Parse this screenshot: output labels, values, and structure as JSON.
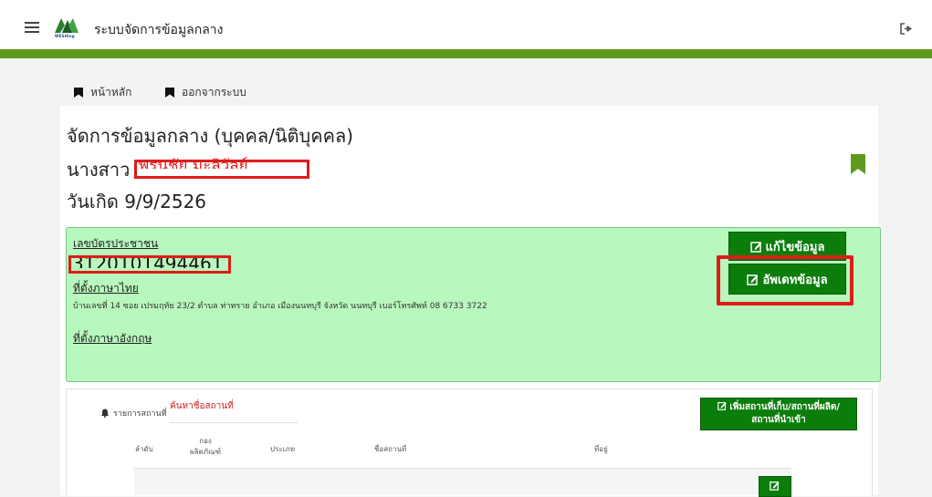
{
  "topbar": {
    "app_title": "ระบบจัดการข้อมูลกลาง",
    "logo_text": "WESHlog"
  },
  "nav": {
    "home": "หน้าหลัก",
    "logout": "ออกจากระบบ"
  },
  "header": {
    "title": "จัดการข้อมูลกลาง (บุคคล/นิติบุคคล)",
    "name_prefix": "นางสาว",
    "name_redacted": "พรนุชัย มะลิวัลย์",
    "birthdate": "วันเกิด 9/9/2526"
  },
  "info": {
    "id_label": "เลขบัตรประชาชน",
    "id_value": "3120101494461",
    "addr_th_label": "ที่ตั้งภาษาไทย",
    "addr_th_value": "บ้านเลขที่ 14 ซอย เปรมฤทัย 23/2 ตำบล ท่าทราย อำเภอ เมืองนนทบุรี จังหวัด นนทบุรี เบอร์โทรศัพท์ 08 6733 3722",
    "addr_en_label": "ที่ตั้งภาษาอังกฤษ"
  },
  "buttons": {
    "edit": "แก้ไขข้อมูล",
    "update": "อัพเดทข้อมูล",
    "add_place_line1": "เพิ่มสถานที่เก็บ/สถานที่ผลิต/",
    "add_place_line2": "สถานที่นำเข้า"
  },
  "places": {
    "list_label": "รายการสถานที่",
    "search_placeholder": "ค้นหาชื่อสถานที่",
    "columns": [
      "ลำดับ",
      "กอง ผลิตภัณฑ์",
      "ประเภท",
      "ชื่อสถานที่",
      "ที่อยู่"
    ]
  },
  "colors": {
    "brand_green": "#5f9a1e",
    "button_green": "#0b7d0b",
    "info_bg": "#b8f7bd",
    "highlight_red": "#e01b1b"
  }
}
